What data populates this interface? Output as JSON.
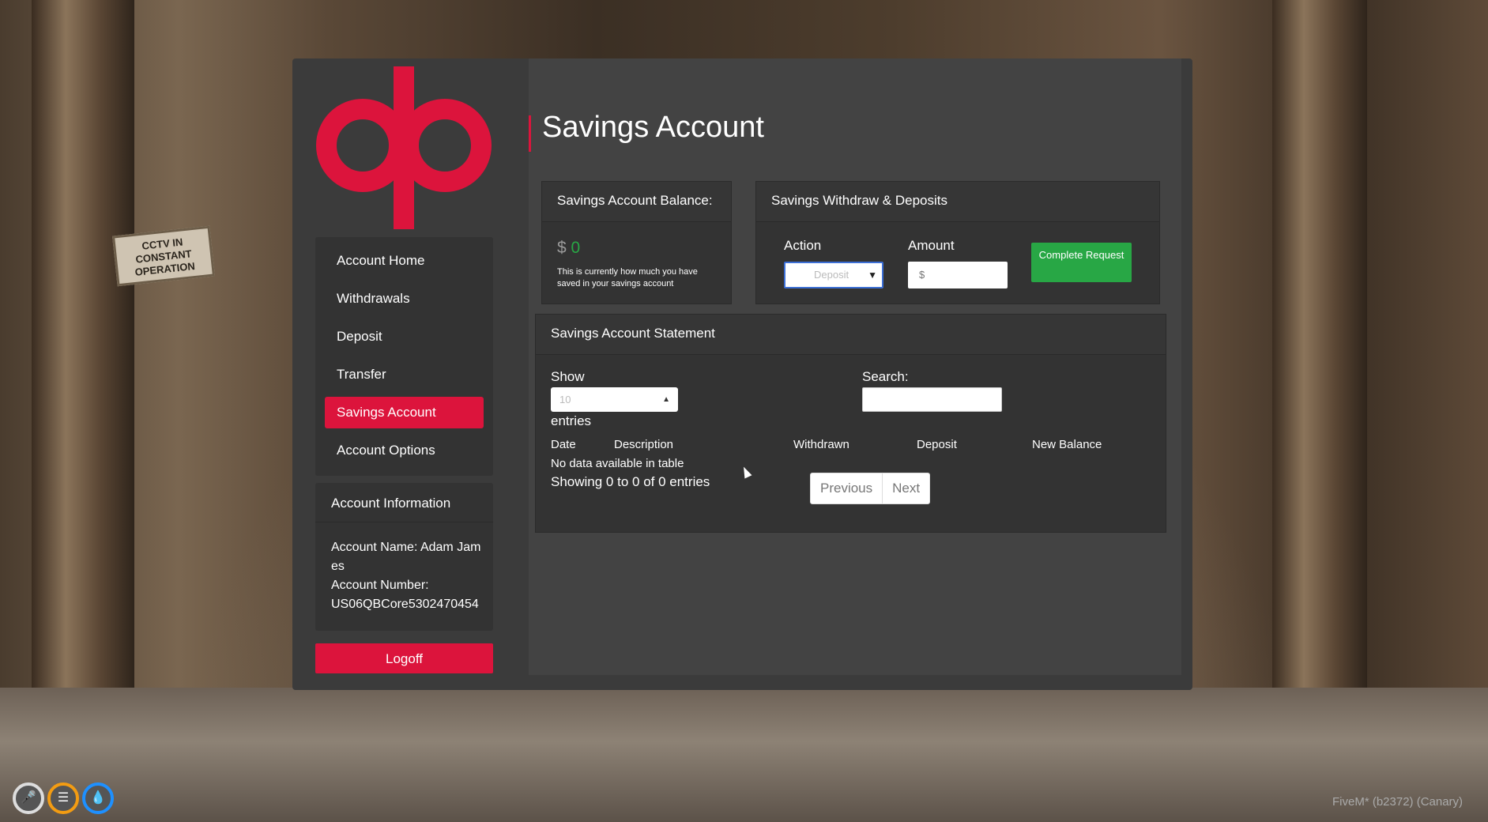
{
  "background": {
    "cctv_sign": "CCTV IN CONSTANT OPERATION"
  },
  "brand": {
    "accent": "#dc143c",
    "success": "#28a745"
  },
  "sidebar": {
    "items": [
      {
        "label": "Account Home"
      },
      {
        "label": "Withdrawals"
      },
      {
        "label": "Deposit"
      },
      {
        "label": "Transfer"
      },
      {
        "label": "Savings Account",
        "active": true
      },
      {
        "label": "Account Options"
      }
    ],
    "info": {
      "title": "Account Information",
      "name_line": "Account Name: Adam James",
      "number_label": "Account Number:",
      "number_value": "US06QBCore5302470454"
    },
    "logoff_label": "Logoff"
  },
  "main": {
    "title": "Savings Account",
    "balance_card": {
      "title": "Savings Account Balance:",
      "currency": "$",
      "amount": "0",
      "note": "This is currently how much you have saved in your savings account"
    },
    "transfer_card": {
      "title": "Savings Withdraw & Deposits",
      "action_label": "Action",
      "action_value": "Deposit",
      "amount_label": "Amount",
      "amount_placeholder": "$",
      "submit_label": "Complete Request"
    },
    "statement": {
      "title": "Savings Account Statement",
      "show_label": "Show",
      "show_value": "10",
      "entries_label": "entries",
      "search_label": "Search:",
      "columns": [
        "Date",
        "Description",
        "Withdrawn",
        "Deposit",
        "New Balance"
      ],
      "empty_text": "No data available in table",
      "showing_text": "Showing 0 to 0 of 0 entries",
      "prev_label": "Previous",
      "next_label": "Next"
    }
  },
  "hud": {
    "icons": [
      "microphone-icon",
      "burger-icon",
      "water-drop-icon"
    ]
  },
  "footer": {
    "build_text": "FiveM* (b2372) (Canary)"
  }
}
